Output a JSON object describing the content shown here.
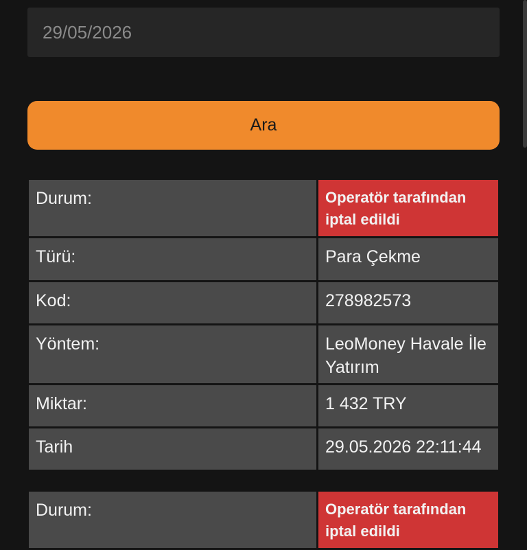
{
  "search": {
    "date_value": "29/05/2026",
    "button_label": "Ara"
  },
  "transactions": [
    {
      "status_label": "Durum:",
      "status_value": "Operatör tarafından iptal edildi",
      "type_label": "Türü:",
      "type_value": "Para Çekme",
      "code_label": "Kod:",
      "code_value": "278982573",
      "method_label": "Yöntem:",
      "method_value": "LeoMoney Havale İle Yatırım",
      "amount_label": "Miktar:",
      "amount_value": "1 432 TRY",
      "date_label": "Tarih",
      "date_value": "29.05.2026 22:11:44"
    },
    {
      "status_label": "Durum:",
      "status_value": "Operatör tarafından iptal edildi"
    }
  ],
  "colors": {
    "background": "#141414",
    "accent": "#f08a2c",
    "status_cancelled": "#cf3535",
    "cell": "#4a4a4a"
  }
}
